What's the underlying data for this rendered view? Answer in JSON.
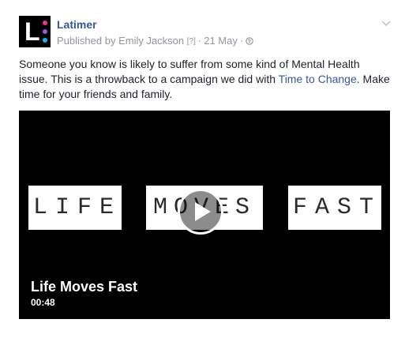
{
  "post": {
    "page_name": "Latimer",
    "avatar_letter": "L",
    "meta": {
      "prefix": "Published by ",
      "author": "Emily Jackson",
      "help": "[?]",
      "separator": "·",
      "date": "21 May",
      "audience_icon": "globe-icon"
    },
    "text": {
      "part1": "Someone you know is likely to suffer from some kind of Mental Health issue. This is a throwback to a campaign we did with ",
      "link": "Time to Change",
      "part2": ". Make time for your friends and family."
    },
    "video": {
      "frame_words": [
        "LIFE",
        "MOVES",
        "FAST"
      ],
      "title": "Life Moves Fast",
      "duration": "00:48"
    }
  },
  "colors": {
    "link": "#365899",
    "meta": "#90949c",
    "text": "#1d2129",
    "video_bg": "#000000",
    "avatar_dots": [
      "#e8368f",
      "#9b59d0",
      "#19b3e6"
    ]
  }
}
